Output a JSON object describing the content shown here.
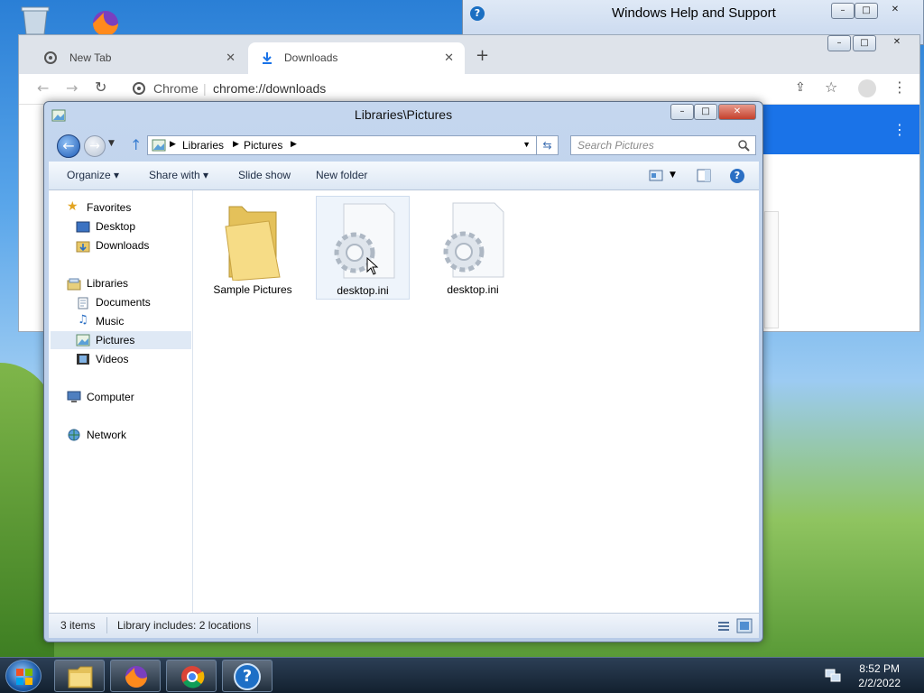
{
  "help_window": {
    "title": "Windows Help and Support"
  },
  "chrome": {
    "tabs": [
      {
        "label": "New Tab"
      },
      {
        "label": "Downloads"
      }
    ],
    "omnibox": {
      "site_label": "Chrome",
      "url": "chrome://downloads"
    }
  },
  "explorer": {
    "title": "Libraries\\Pictures",
    "breadcrumb": [
      "Libraries",
      "Pictures"
    ],
    "search_placeholder": "Search Pictures",
    "commands": [
      "Organize",
      "Share with",
      "Slide show",
      "New folder"
    ],
    "nav": {
      "favorites": {
        "label": "Favorites",
        "items": [
          "Desktop",
          "Downloads"
        ]
      },
      "libraries": {
        "label": "Libraries",
        "items": [
          "Documents",
          "Music",
          "Pictures",
          "Videos"
        ]
      },
      "computer": "Computer",
      "network": "Network"
    },
    "items": [
      {
        "name": "Sample Pictures",
        "type": "folder"
      },
      {
        "name": "desktop.ini",
        "type": "config-file"
      },
      {
        "name": "desktop.ini",
        "type": "config-file"
      }
    ],
    "status": {
      "count": "3 items",
      "library": "Library includes: 2 locations"
    }
  },
  "taskbar": {
    "time": "8:52 PM",
    "date": "2/2/2022"
  },
  "colors": {
    "selection": "#dfe9f5",
    "taskbar": "#12202f",
    "chrome_accent": "#1a73e8"
  }
}
